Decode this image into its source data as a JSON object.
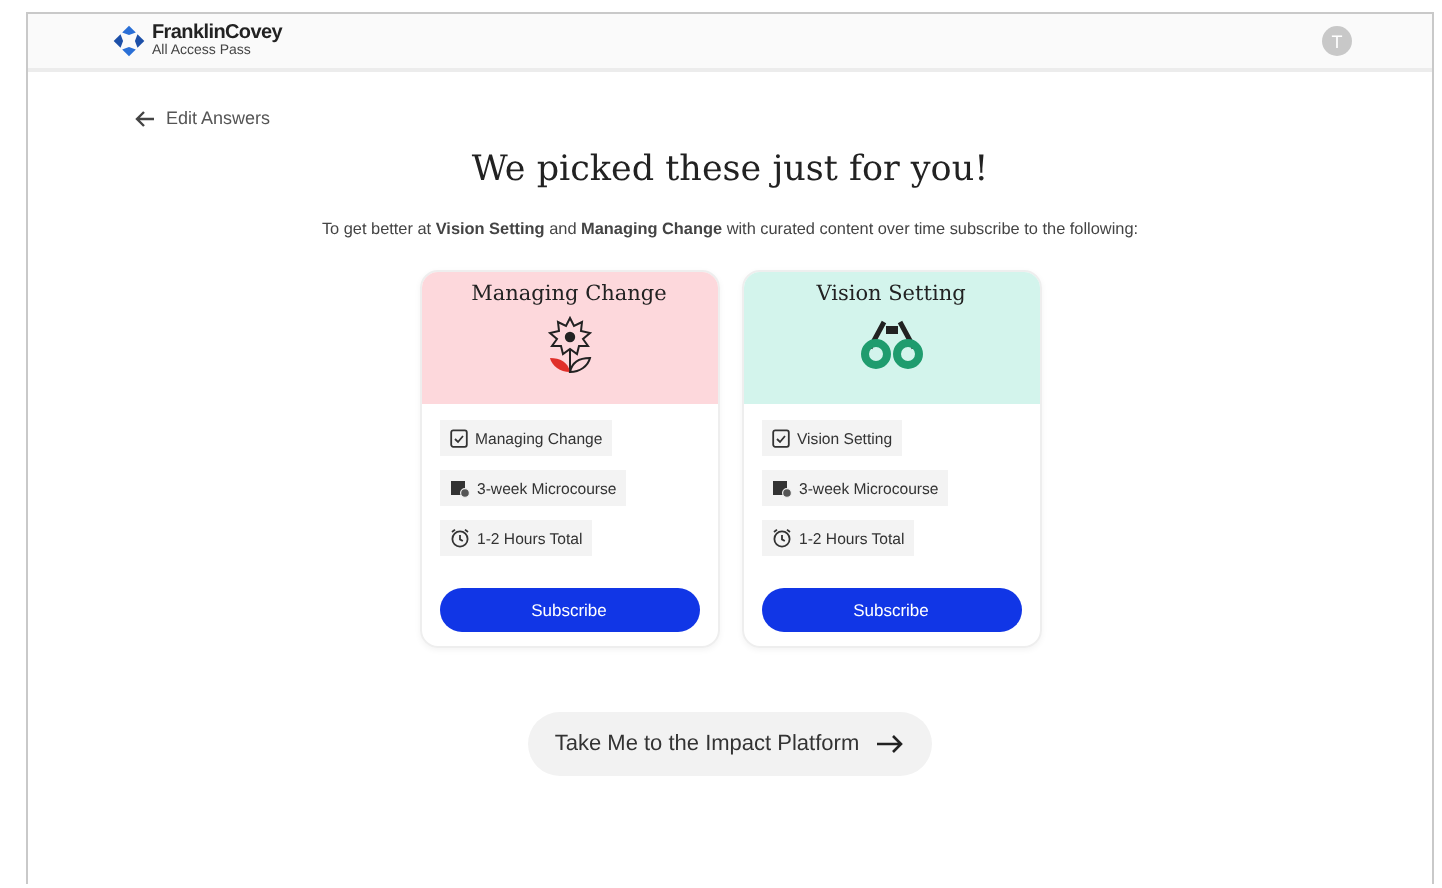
{
  "header": {
    "brand": "FranklinCovey",
    "subbrand": "All Access Pass",
    "avatar": "T"
  },
  "back_link": "Edit Answers",
  "title": "We picked these just for you!",
  "intro": "To get better at **Vision Setting** and **Managing Change** with curated content over time subscribe to the following:",
  "cards": [
    {
      "title": "Managing Change",
      "kind": "flower",
      "color": "#fdd8dc",
      "features": [
        {
          "kind": "clipboard",
          "text": "Managing Change"
        },
        {
          "kind": "calendar",
          "text": "3-week Microcourse"
        },
        {
          "kind": "clock",
          "text": "1-2 Hours Total"
        }
      ],
      "button": "Subscribe"
    },
    {
      "title": "Vision Setting",
      "kind": "binoculars",
      "color": "#d3f4ec",
      "features": [
        {
          "kind": "clipboard",
          "text": "Vision Setting"
        },
        {
          "kind": "calendar",
          "text": "3-week Microcourse"
        },
        {
          "kind": "clock",
          "text": "1-2 Hours Total"
        }
      ],
      "button": "Subscribe"
    }
  ],
  "platform_button": "Take Me to the Impact Platform"
}
